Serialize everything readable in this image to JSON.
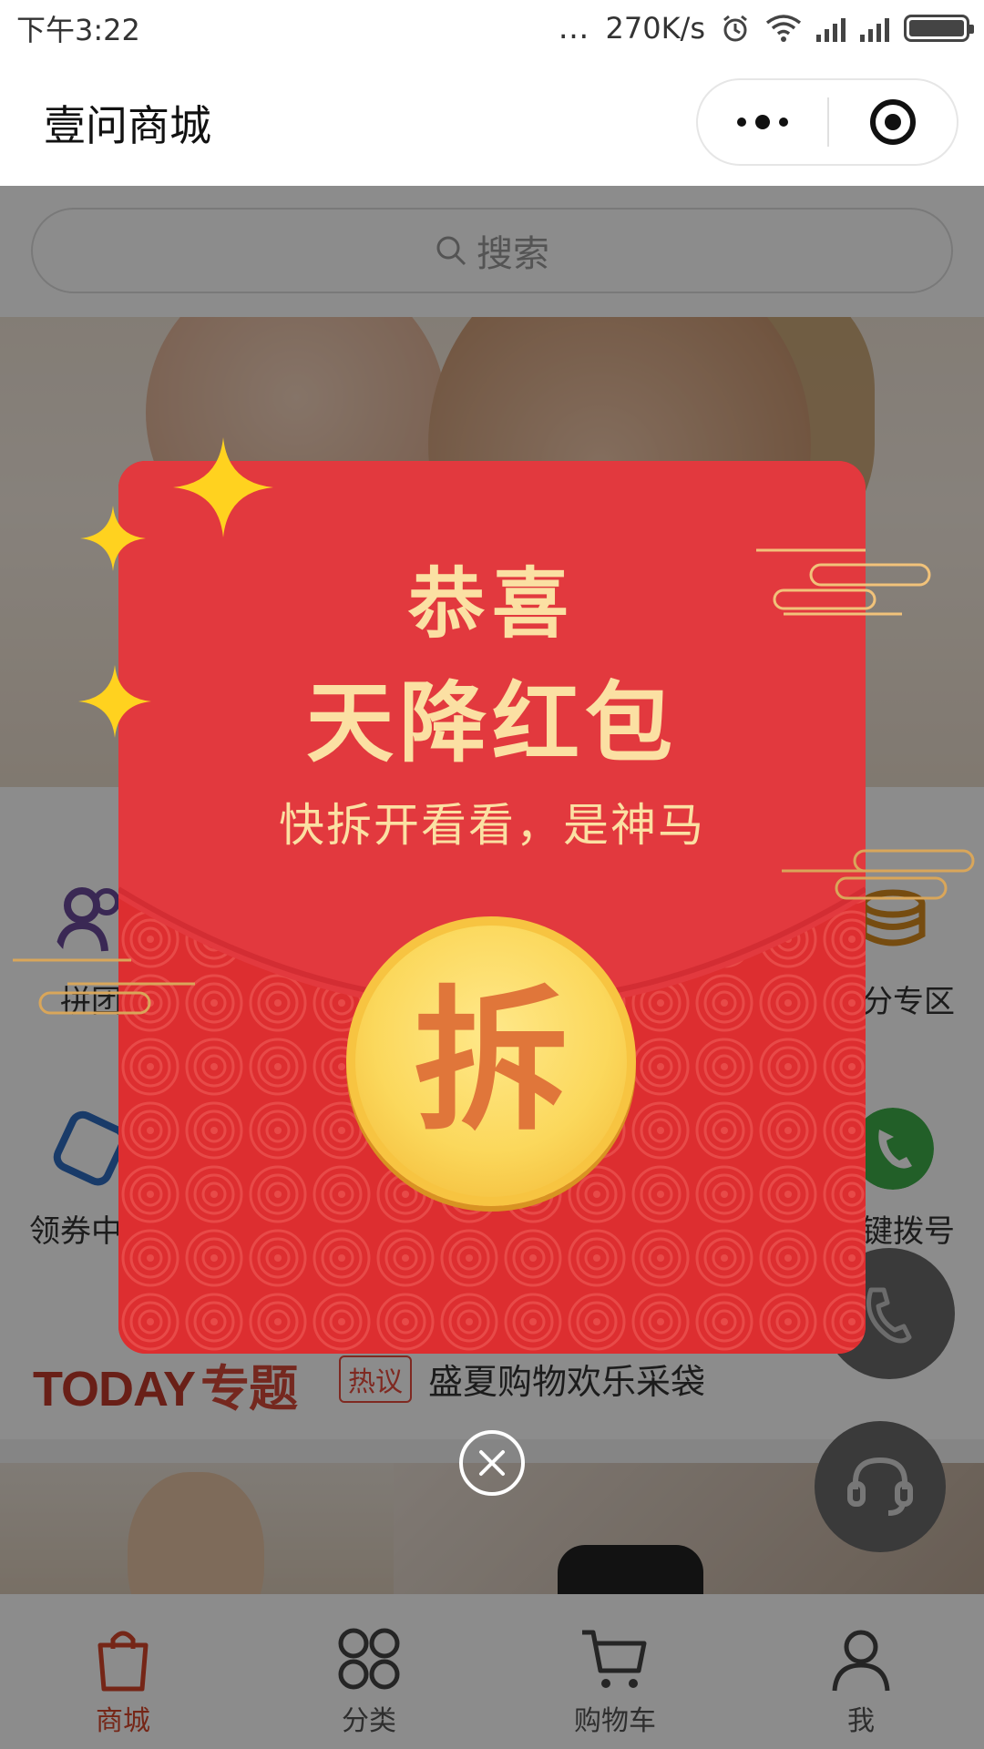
{
  "status_bar": {
    "time": "下午3:22",
    "dots": "…",
    "speed": "270K/s"
  },
  "title_bar": {
    "title": "壹问商城"
  },
  "search": {
    "placeholder": "搜索"
  },
  "nav_items": [
    {
      "label": "拼团"
    },
    {
      "label": "积分专区"
    },
    {
      "label": "领券中心"
    },
    {
      "label": "一键拨号"
    }
  ],
  "today": {
    "logo_today": "TODAY",
    "logo_topic": "专题",
    "hot_tag": "热议",
    "hot_text": "盛夏购物欢乐采袋"
  },
  "red_packet": {
    "line1": "恭喜",
    "line2": "天降红包",
    "line3": "快拆开看看，是神马",
    "open_button": "拆"
  },
  "tabs": [
    {
      "label": "商城",
      "icon": "shopping-bag-icon",
      "active": true
    },
    {
      "label": "分类",
      "icon": "category-icon",
      "active": false
    },
    {
      "label": "购物车",
      "icon": "cart-icon",
      "active": false
    },
    {
      "label": "我",
      "icon": "user-icon",
      "active": false
    }
  ],
  "colors": {
    "accent": "#d6452b",
    "packet_red": "#e03a3a",
    "packet_text": "#fbe0a3",
    "coin_gold": "#fbd85c"
  }
}
